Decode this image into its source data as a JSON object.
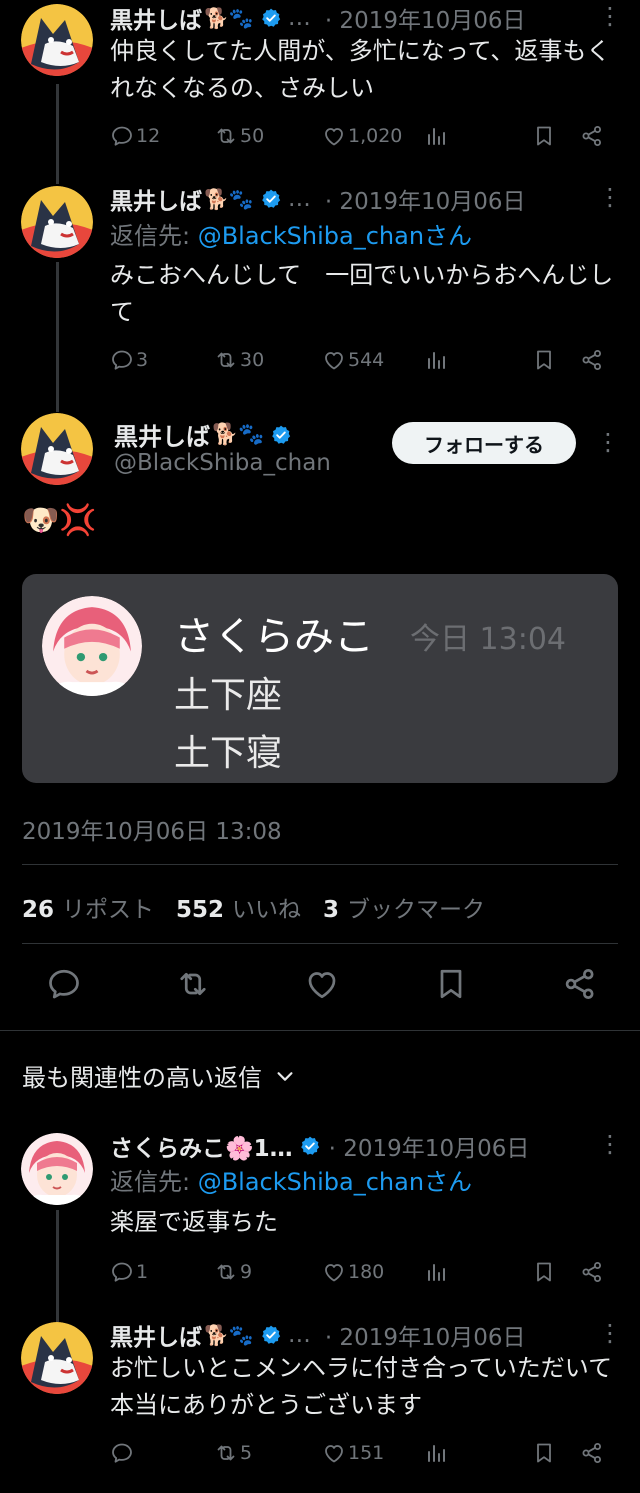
{
  "tweets_above": [
    {
      "name": "黒井しば",
      "emoji": "🐕🐾",
      "ellipsis": "…",
      "date": "· 2019年10月06日",
      "text": "仲良くしてた人間が、多忙になって、返事もくれなくなるの、さみしい",
      "replies": "12",
      "retweets": "50",
      "likes": "1,020"
    },
    {
      "name": "黒井しば",
      "emoji": "🐕🐾",
      "ellipsis": "…",
      "date": "· 2019年10月06日",
      "reply_prefix": "返信先: ",
      "reply_mention": "@BlackShiba_chanさん",
      "text": "みこおへんじして　一回でいいからおへんじして",
      "replies": "3",
      "retweets": "30",
      "likes": "544"
    }
  ],
  "main": {
    "name": "黒井しば",
    "emoji": "🐕🐾",
    "handle": "@BlackShiba_chan",
    "follow_label": "フォローする",
    "text": "🐶💢",
    "card": {
      "name": "さくらみこ",
      "time": "今日 13:04",
      "line1": "土下座",
      "line2": "土下寝"
    },
    "timestamp": "2019年10月06日 13:08",
    "stats": {
      "reposts_count": "26",
      "reposts_label": "リポスト",
      "likes_count": "552",
      "likes_label": "いいね",
      "bookmarks_count": "3",
      "bookmarks_label": "ブックマーク"
    }
  },
  "sort_label": "最も関連性の高い返信",
  "replies": [
    {
      "name": "さくらみこ🌸1…",
      "date": "· 2019年10月06日",
      "reply_prefix": "返信先: ",
      "reply_mention": "@BlackShiba_chanさん",
      "text": "楽屋で返事ちた",
      "replies": "1",
      "retweets": "9",
      "likes": "180"
    },
    {
      "name": "黒井しば",
      "emoji": "🐕🐾",
      "ellipsis": "…",
      "date": "· 2019年10月06日",
      "text": "お忙しいとこメンヘラに付き合っていただいて本当にありがとうございます",
      "replies": "",
      "retweets": "5",
      "likes": "151"
    }
  ],
  "icons": [
    "reply-icon",
    "retweet-icon",
    "like-icon",
    "views-icon",
    "bookmark-icon",
    "share-icon",
    "verified-icon",
    "more-icon",
    "chevron-down-icon"
  ],
  "colors": {
    "background": "#000000",
    "text": "#e7e9ea",
    "muted": "#71767b",
    "link": "#1d9bf0",
    "card": "#3a3b3f"
  }
}
